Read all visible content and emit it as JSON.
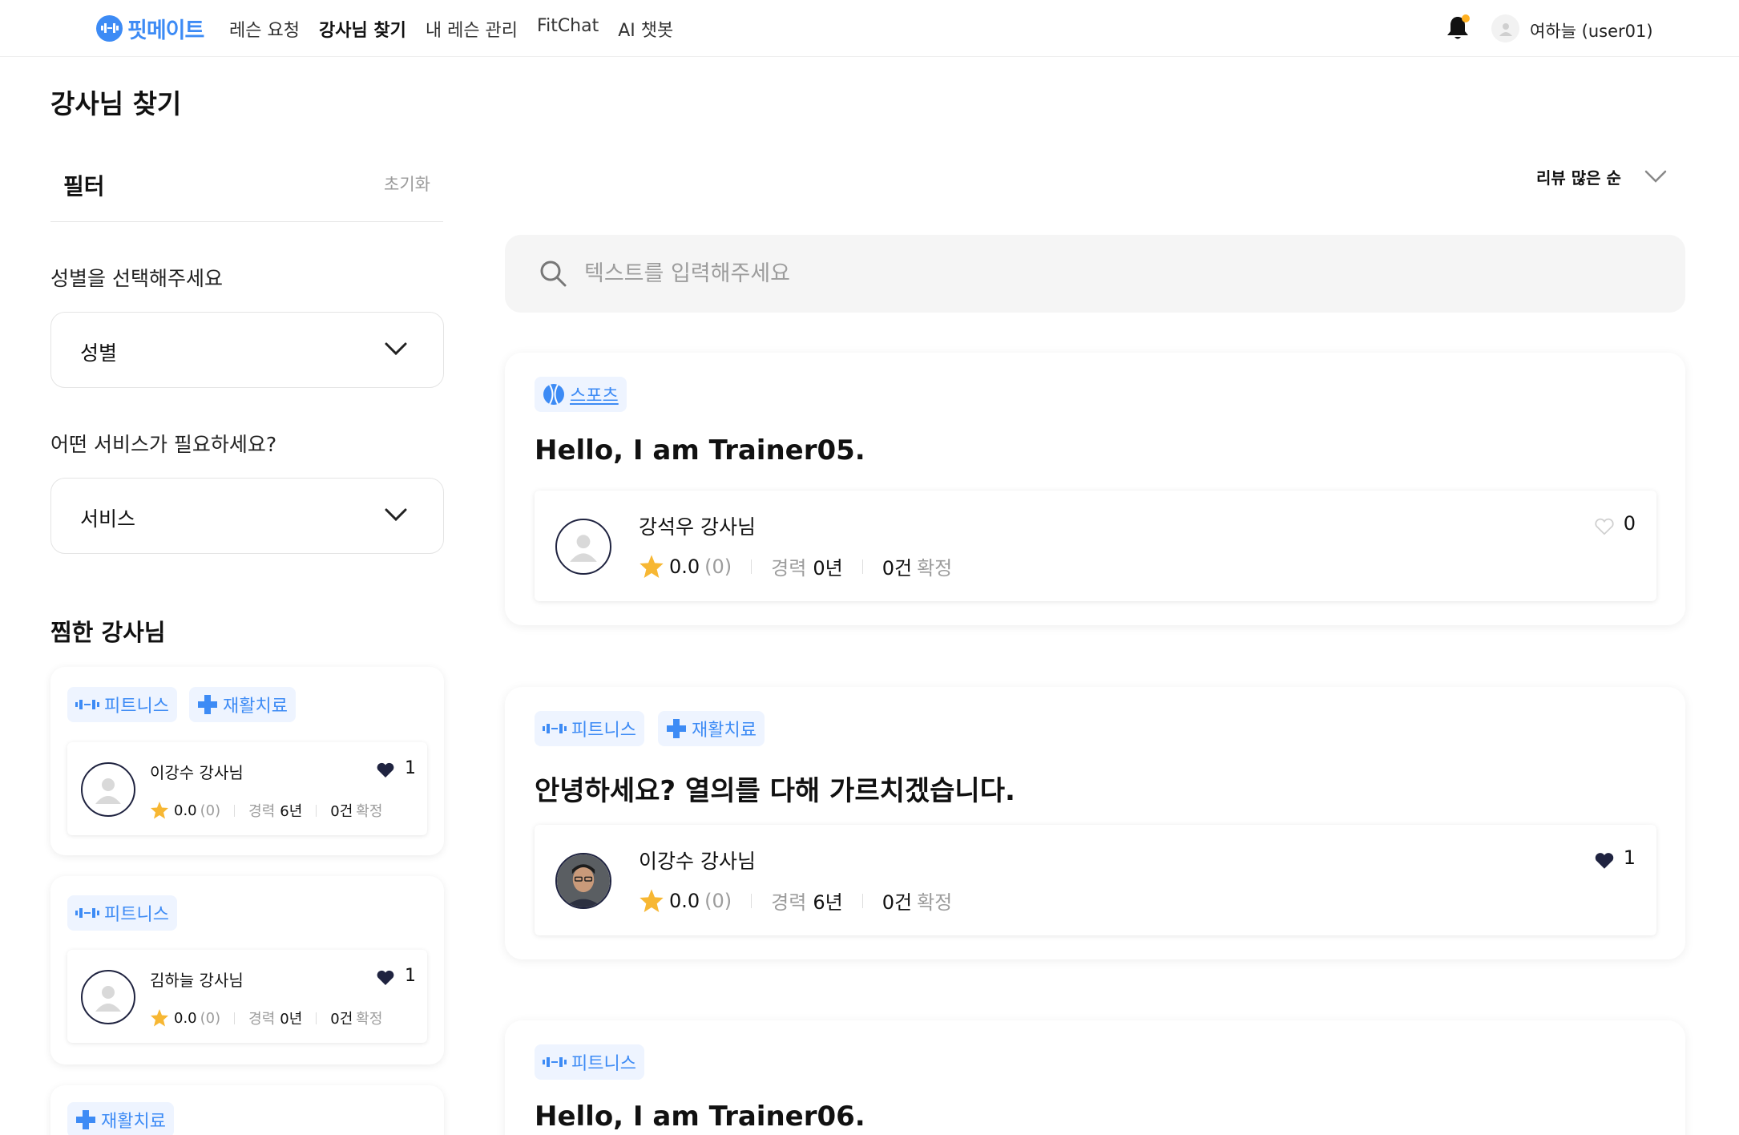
{
  "header": {
    "logo_text": "핏메이트",
    "nav": [
      "레슨 요청",
      "강사님 찾기",
      "내 레슨 관리",
      "FitChat",
      "AI 챗봇"
    ],
    "active_nav": "강사님 찾기",
    "user_name": "여하늘 (user01)"
  },
  "page_title": "강사님 찾기",
  "filter": {
    "title": "필터",
    "reset_label": "초기화",
    "gender_label": "성별을 선택해주세요",
    "gender_value": "성별",
    "service_label": "어떤 서비스가 필요하세요?",
    "service_value": "서비스"
  },
  "favorites": {
    "title": "찜한 강사님",
    "items": [
      {
        "tags": [
          "피트니스",
          "재활치료"
        ],
        "name": "이강수 강사님",
        "likes": "1",
        "rating": "0.0",
        "reviews": "(0)",
        "career_label": "경력",
        "career": "6년",
        "count": "0건",
        "count_label": "확정"
      },
      {
        "tags": [
          "피트니스"
        ],
        "name": "김하늘 강사님",
        "likes": "1",
        "rating": "0.0",
        "reviews": "(0)",
        "career_label": "경력",
        "career": "0년",
        "count": "0건",
        "count_label": "확정"
      },
      {
        "tags": [
          "재활치료"
        ]
      }
    ]
  },
  "sort": {
    "label": "리뷰 많은 순"
  },
  "search": {
    "placeholder": "텍스트를 입력해주세요"
  },
  "trainers": [
    {
      "tags": [
        "스포츠"
      ],
      "title": "Hello, I am Trainer05.",
      "name": "강석우 강사님",
      "likes": "0",
      "liked": false,
      "rating": "0.0",
      "reviews": "(0)",
      "career_label": "경력",
      "career": "0년",
      "count": "0건",
      "count_label": "확정"
    },
    {
      "tags": [
        "피트니스",
        "재활치료"
      ],
      "title": "안녕하세요? 열의를 다해 가르치겠습니다.",
      "name": "이강수 강사님",
      "likes": "1",
      "liked": true,
      "rating": "0.0",
      "reviews": "(0)",
      "career_label": "경력",
      "career": "6년",
      "count": "0건",
      "count_label": "확정"
    },
    {
      "tags": [
        "피트니스"
      ],
      "title": "Hello, I am Trainer06."
    }
  ],
  "colors": {
    "accent": "#3d8bf5",
    "tag_bg": "#eef4ff",
    "heart": "#1f2340",
    "star": "#f7b733"
  }
}
